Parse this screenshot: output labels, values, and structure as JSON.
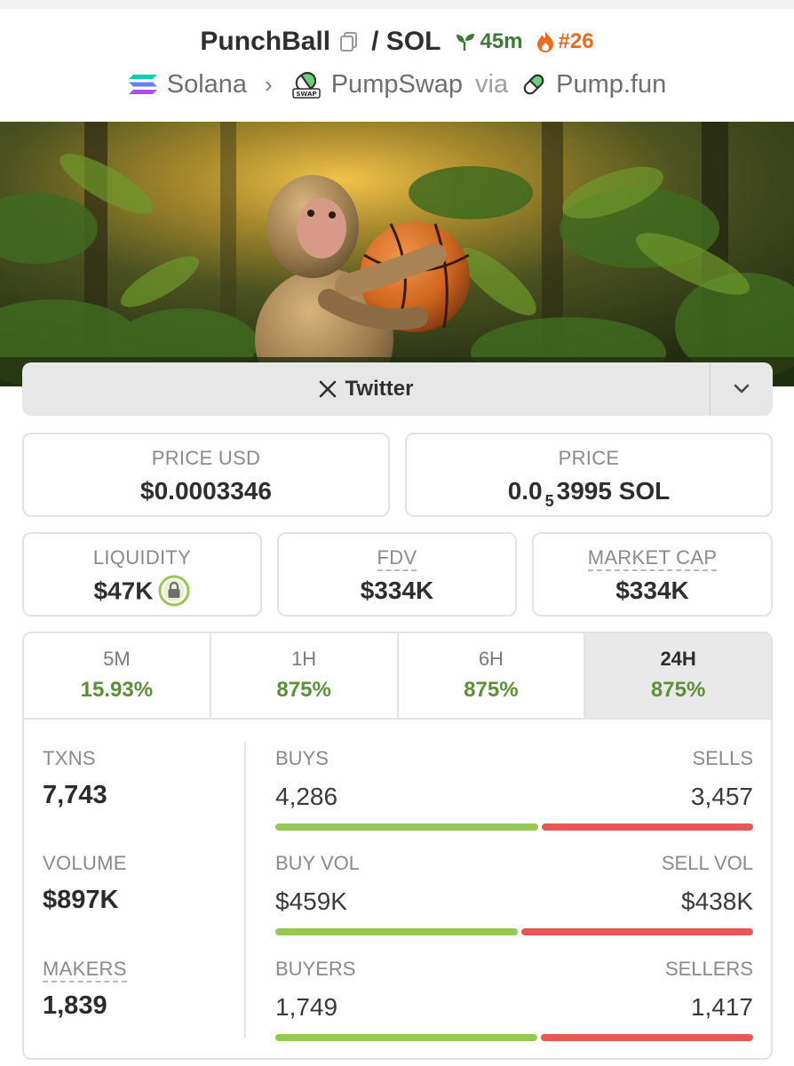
{
  "header": {
    "token": "PunchBall",
    "pair": "/ SOL",
    "age": "45m",
    "rank": "#26",
    "chain": "Solana",
    "dex": "PumpSwap",
    "via": "via",
    "launchpad": "Pump.fun"
  },
  "social": {
    "twitter_label": "Twitter"
  },
  "prices": {
    "price_usd_label": "PRICE USD",
    "price_usd": "$0.0003346",
    "price_label": "PRICE",
    "price_sol_prefix": "0.0",
    "price_sol_zeros": "5",
    "price_sol_rest": "3995 SOL"
  },
  "metrics": {
    "liquidity_label": "LIQUIDITY",
    "liquidity": "$47K",
    "fdv_label": "FDV",
    "fdv": "$334K",
    "mcap_label": "MARKET CAP",
    "mcap": "$334K"
  },
  "tabs": [
    {
      "label": "5M",
      "value": "15.93%"
    },
    {
      "label": "1H",
      "value": "875%"
    },
    {
      "label": "6H",
      "value": "875%"
    },
    {
      "label": "24H",
      "value": "875%",
      "active": true
    }
  ],
  "stats": {
    "txns_label": "TXNS",
    "txns": "7,743",
    "volume_label": "VOLUME",
    "volume": "$897K",
    "makers_label": "MAKERS",
    "makers": "1,839",
    "buys_label": "BUYS",
    "buys": "4,286",
    "sells_label": "SELLS",
    "sells": "3,457",
    "buy_vol_label": "BUY VOL",
    "buy_vol": "$459K",
    "sell_vol_label": "SELL VOL",
    "sell_vol": "$438K",
    "buyers_label": "BUYERS",
    "buyers": "1,749",
    "sellers_label": "SELLERS",
    "sellers": "1,417"
  },
  "ratios": {
    "buys_share": 0.5535,
    "buy_vol_share": 0.5117,
    "buyers_share": 0.5524
  },
  "colors": {
    "positive": "#5d8f37",
    "buy_bar": "#94c954",
    "sell_bar": "#e95656",
    "age": "#3d7a35",
    "rank": "#ee6a1c"
  }
}
